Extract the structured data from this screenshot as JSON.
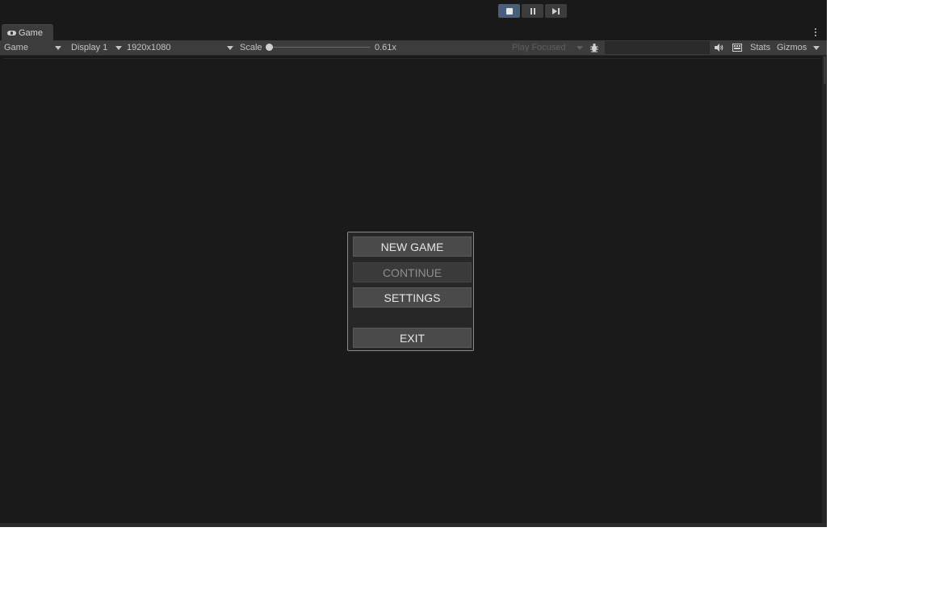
{
  "play_toolbar": {
    "stop": "stop-icon",
    "pause": "pause-icon",
    "step": "step-icon"
  },
  "tab": {
    "label": "Game",
    "icon": "gamepad-icon"
  },
  "toolbar": {
    "view_mode": "Game",
    "display": "Display 1",
    "resolution": "1920x1080",
    "scale_label": "Scale",
    "scale_value": "0.61x",
    "play_mode": "Play Focused",
    "stats": "Stats",
    "gizmos": "Gizmos"
  },
  "menu": {
    "new_game": "NEW GAME",
    "continue": "CONTINUE",
    "settings": "SETTINGS",
    "exit": "EXIT"
  },
  "colors": {
    "editor_bg": "#191919",
    "toolbar_bg": "#3c3c3c",
    "play_active": "#46607c"
  }
}
